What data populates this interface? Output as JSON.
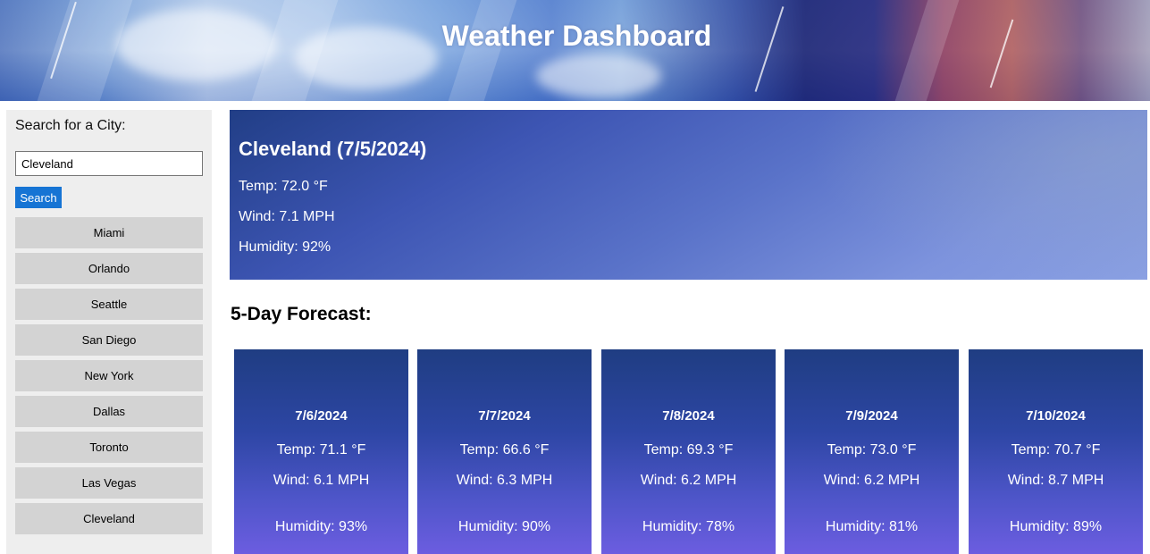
{
  "header": {
    "title": "Weather Dashboard"
  },
  "sidebar": {
    "heading": "Search for a City:",
    "search_value": "Cleveland",
    "search_button": "Search",
    "history": [
      "Miami",
      "Orlando",
      "Seattle",
      "San Diego",
      "New York",
      "Dallas",
      "Toronto",
      "Las Vegas",
      "Cleveland"
    ]
  },
  "current": {
    "title": "Cleveland (7/5/2024)",
    "temp": "Temp: 72.0 °F",
    "wind": "Wind: 7.1 MPH",
    "humidity": "Humidity: 92%"
  },
  "forecast": {
    "heading": "5-Day Forecast:",
    "days": [
      {
        "date": "7/6/2024",
        "temp": "Temp: 71.1 °F",
        "wind": "Wind: 6.1 MPH",
        "humidity": "Humidity: 93%"
      },
      {
        "date": "7/7/2024",
        "temp": "Temp: 66.6 °F",
        "wind": "Wind: 6.3 MPH",
        "humidity": "Humidity: 90%"
      },
      {
        "date": "7/8/2024",
        "temp": "Temp: 69.3 °F",
        "wind": "Wind: 6.2 MPH",
        "humidity": "Humidity: 78%"
      },
      {
        "date": "7/9/2024",
        "temp": "Temp: 73.0 °F",
        "wind": "Wind: 6.2 MPH",
        "humidity": "Humidity: 81%"
      },
      {
        "date": "7/10/2024",
        "temp": "Temp: 70.7 °F",
        "wind": "Wind: 8.7 MPH",
        "humidity": "Humidity: 89%"
      }
    ]
  },
  "colors": {
    "search_button": "#1674d4",
    "history_item": "#d3d3d3",
    "sidebar_bg": "#eeeeee"
  }
}
